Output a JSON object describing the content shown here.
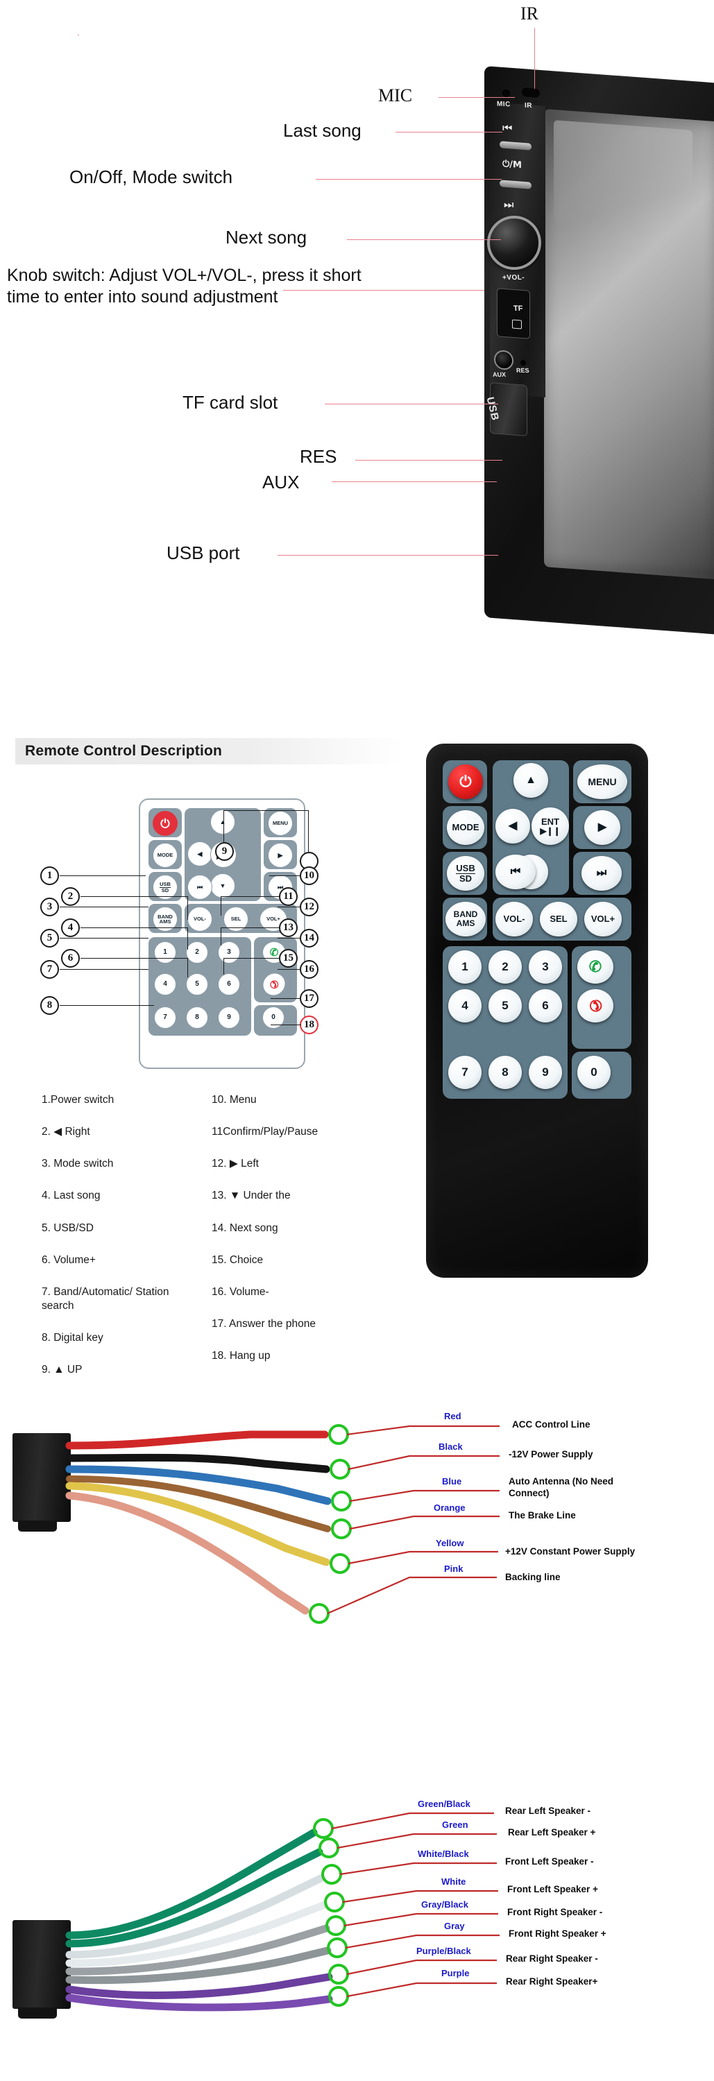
{
  "unit": {
    "callouts": [
      {
        "id": "ir",
        "text": "IR"
      },
      {
        "id": "mic",
        "text": "MIC"
      },
      {
        "id": "last-song",
        "text": "Last song"
      },
      {
        "id": "onoff-mode",
        "text": "On/Off, Mode switch"
      },
      {
        "id": "next-song",
        "text": "Next song"
      },
      {
        "id": "knob",
        "text": "Knob switch: Adjust VOL+/VOL-, press it short time to enter into sound adjustment"
      },
      {
        "id": "tf-card",
        "text": "TF card slot"
      },
      {
        "id": "res",
        "text": "RES"
      },
      {
        "id": "aux",
        "text": "AUX"
      },
      {
        "id": "usb",
        "text": "USB port"
      }
    ],
    "panel_marks": {
      "mic": "MIC",
      "ir": "IR",
      "prev": "⏮",
      "power_mode": "⏻/M",
      "next": "⏭",
      "vol": "+VOL-",
      "tf": "TF",
      "aux": "AUX",
      "res": "RES",
      "usb": "USB"
    }
  },
  "remote": {
    "title": "Remote Control Description",
    "keys": {
      "power": "⏻",
      "mode": "MODE",
      "usb_sd_top": "USB",
      "usb_sd_bottom": "SD",
      "band_top": "BAND",
      "band_bottom": "AMS",
      "up": "▲",
      "down": "▼",
      "left": "◀",
      "right": "▶",
      "ent_top": "ENT",
      "ent_bottom": "▶❙❙",
      "menu": "MENU",
      "prev": "⏮",
      "next": "⏭",
      "vol_minus": "VOL-",
      "vol_plus": "VOL+",
      "sel": "SEL",
      "answer": "✆",
      "hangup": "✆",
      "digits": [
        "1",
        "2",
        "3",
        "4",
        "5",
        "6",
        "7",
        "8",
        "9",
        "0"
      ]
    },
    "callout_numbers": [
      "1",
      "2",
      "3",
      "4",
      "5",
      "6",
      "7",
      "8",
      "9",
      "10",
      "11",
      "12",
      "13",
      "14",
      "15",
      "16",
      "17",
      "18"
    ],
    "legend_left": [
      "1.Power switch",
      "2. ◀ Right",
      "3. Mode switch",
      "4. Last song",
      "5. USB/SD",
      "6. Volume+",
      "7. Band/Automatic/ Station search",
      "8. Digital key",
      "9. ▲ UP"
    ],
    "legend_right": [
      "10. Menu",
      "11Confirm/Play/Pause",
      "12. ▶  Left",
      "13. ▼  Under the",
      "14. Next song",
      "15. Choice",
      "16. Volume-",
      "17. Answer the phone",
      "18. Hang up"
    ]
  },
  "wiring_power": {
    "wires": [
      {
        "name": "Red",
        "desc": "ACC Control Line",
        "color": "#d02828"
      },
      {
        "name": "Black",
        "desc": "-12V Power Supply",
        "color": "#141414"
      },
      {
        "name": "Blue",
        "desc": "Auto Antenna (No Need Connect)",
        "color": "#2f74b8"
      },
      {
        "name": "Orange",
        "desc": "The Brake Line",
        "color": "#9a6434"
      },
      {
        "name": "Yellow",
        "desc": "+12V Constant Power Supply",
        "color": "#e0c44a"
      },
      {
        "name": "Pink",
        "desc": "Backing line",
        "color": "#e09a87"
      }
    ]
  },
  "wiring_speaker": {
    "wires": [
      {
        "name": "Green/Black",
        "desc": "Rear Left Speaker -",
        "color": "#0e8a63"
      },
      {
        "name": "Green",
        "desc": "Rear Left Speaker +",
        "color": "#0e8a63"
      },
      {
        "name": "White/Black",
        "desc": "Front Left Speaker -",
        "color": "#d7dee1"
      },
      {
        "name": "White",
        "desc": "Front Left Speaker +",
        "color": "#e5eaec"
      },
      {
        "name": "Gray/Black",
        "desc": "Front Right Speaker -",
        "color": "#9aa0a3"
      },
      {
        "name": "Gray",
        "desc": "Front Right Speaker +",
        "color": "#8e9598"
      },
      {
        "name": "Purple/Black",
        "desc": "Rear Right Speaker -",
        "color": "#6b3f9e"
      },
      {
        "name": "Purple",
        "desc": "Rear Right Speaker+",
        "color": "#7a4bb0"
      }
    ]
  },
  "colors": {
    "leader_red": "#e8828c",
    "label_blue": "#1a1ac8",
    "accent_red": "#e3303c",
    "remote_gray": "#8a9ba6",
    "photo_gray": "#5f7b8a"
  }
}
